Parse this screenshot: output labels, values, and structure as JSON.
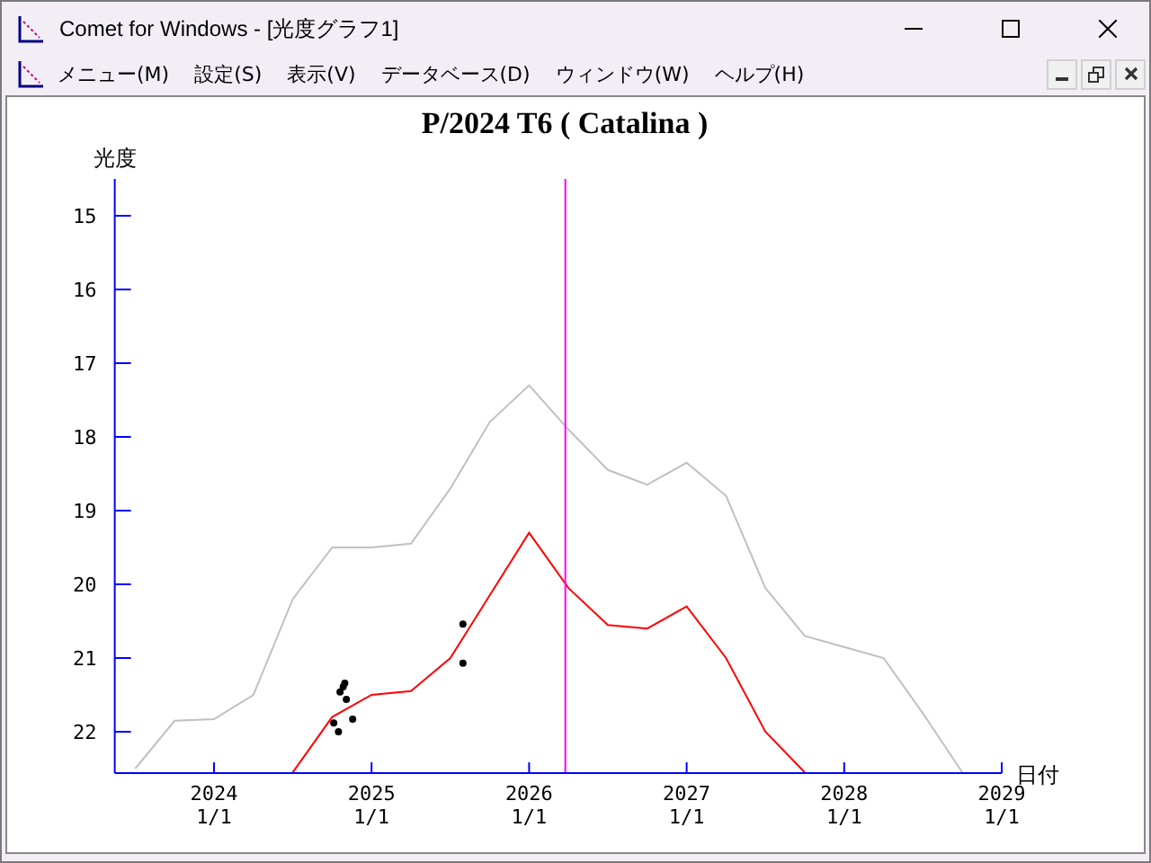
{
  "window": {
    "title": "Comet for Windows - [光度グラフ1]"
  },
  "menu": [
    "メニュー(M)",
    "設定(S)",
    "表示(V)",
    "データベース(D)",
    "ウィンドウ(W)",
    "ヘルプ(H)"
  ],
  "chart": {
    "chart_data": {
      "type": "line",
      "title": "P/2024 T6 ( Catalina )",
      "xlabel": "日付",
      "ylabel": "光度",
      "x": [
        2023.5,
        2023.75,
        2024,
        2024.25,
        2024.5,
        2024.75,
        2025,
        2025.25,
        2025.5,
        2025.75,
        2026,
        2026.25,
        2026.5,
        2026.75,
        2027,
        2027.25,
        2027.5,
        2027.75,
        2028,
        2028.25,
        2028.5,
        2028.75
      ],
      "series": [
        {
          "color": "#c0c0c0",
          "values": [
            22.5,
            21.85,
            21.83,
            21.5,
            20.2,
            19.5,
            19.5,
            19.45,
            18.7,
            17.8,
            17.3,
            17.9,
            18.45,
            18.65,
            18.35,
            18.8,
            20.05,
            20.7,
            20.85,
            21.0,
            21.75,
            22.55
          ]
        },
        {
          "color": "#ff0000",
          "values": [
            null,
            null,
            null,
            null,
            22.55,
            21.8,
            21.5,
            21.45,
            21.0,
            20.15,
            19.3,
            20.05,
            20.55,
            20.6,
            20.3,
            21.0,
            22.0,
            22.55,
            null,
            null,
            null,
            null
          ]
        },
        {
          "color": "#000000",
          "type": "scatter",
          "x": [
            2024.76,
            2024.79,
            2024.82,
            2024.84,
            2024.88,
            2024.83,
            2024.8,
            2025.58,
            2025.58
          ],
          "values": [
            21.88,
            22.0,
            21.39,
            21.56,
            21.83,
            21.34,
            21.46,
            20.54,
            21.07
          ]
        }
      ],
      "xlim": [
        2023.37,
        2029
      ],
      "ylim": [
        22.56,
        14.5
      ],
      "xticks": [
        2024,
        2025,
        2026,
        2027,
        2028,
        2029
      ],
      "yticks": [
        15,
        16,
        17,
        18,
        19,
        20,
        21,
        22
      ],
      "ref_lines": [
        {
          "axis": "x",
          "value": 2026.23,
          "color": "#ff00ff"
        }
      ]
    },
    "x_tick_dates": [
      "1/1",
      "1/1",
      "1/1",
      "1/1",
      "1/1",
      "1/1"
    ]
  }
}
